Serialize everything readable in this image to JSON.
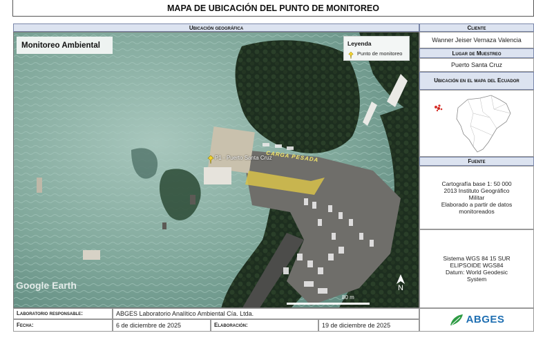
{
  "title": "MAPA DE UBICACIÓN DEL PUNTO DE MONITOREO",
  "map_header": "Ubicación geográfica",
  "map": {
    "inset_title": "Monitoreo Ambiental",
    "legend_title": "Leyenda",
    "legend_item": "Punto de monitoreo",
    "point_label": "P1 - Puerto Santa Cruz",
    "watermark": "Google Earth",
    "scale_label": "80 m",
    "north_label": "N",
    "painted_road_text": "CARGA PESADA"
  },
  "side": {
    "cliente_header": "Cliente",
    "cliente_value": "Wanner Jeiser Vernaza Valencia",
    "lugar_header": "Lugar de Muestreo",
    "lugar_value": "Puerto Santa Cruz",
    "ubicacion_header": "Ubicación en el mapa del Ecuador",
    "fuente_header": "Fuente",
    "fuente_lines": [
      "Cartografía base 1: 50 000",
      "2013 Instituto Geográfico",
      "Militar",
      "Elaborado a partir de datos",
      "monitoreados"
    ],
    "sistema_lines": [
      "Sistema WGS 84 15 SUR",
      "ELIPSOIDE WGS84",
      "Datum: World Geodesic",
      "System"
    ]
  },
  "footer": {
    "lab_label": "Laboratorio responsable:",
    "lab_value": "ABGES Laboratorio Analítico Ambiental Cía. Ltda.",
    "fecha_label": "Fecha:",
    "fecha_value": "6 de diciembre de 2025",
    "elab_label": "Elaboración:",
    "elab_value": "19 de diciembre de 2025",
    "logo_text": "ABGES"
  },
  "colors": {
    "header_bg": "#dce3f0",
    "logo_green": "#2e9b44",
    "logo_blue": "#1f6fb2",
    "marker_yellow": "#f2d22e"
  }
}
